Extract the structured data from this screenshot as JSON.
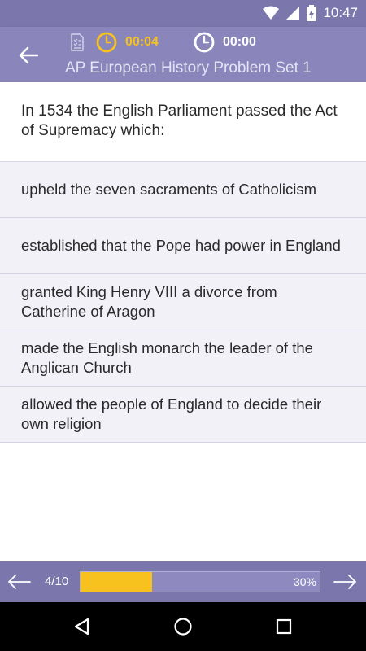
{
  "status_bar": {
    "time": "10:47",
    "icons": [
      "wifi-icon",
      "signal-icon",
      "battery-icon"
    ]
  },
  "app_bar": {
    "title": "AP European History Problem Set 1",
    "elapsed_time": "00:04",
    "total_time": "00:00",
    "icons": [
      "back-arrow-icon",
      "answer-sheet-icon",
      "stopwatch-icon",
      "clock-icon"
    ]
  },
  "question": {
    "text": "In 1534 the English Parliament passed the Act of Supremacy which:"
  },
  "answers": [
    {
      "text": "upheld the seven sacraments of Catholicism"
    },
    {
      "text": "established that the Pope had power in England"
    },
    {
      "text": "granted King Henry VIII a divorce from Catherine of Aragon"
    },
    {
      "text": "made the English monarch the leader of the Anglican Church"
    },
    {
      "text": "allowed the people of England to decide their own religion"
    }
  ],
  "progress": {
    "counter": "4/10",
    "percent_label": "30%",
    "fraction": 0.3
  },
  "colors": {
    "accent": "#f7c21d",
    "app_bar": "#8a86bc",
    "status_bar": "#7b77ad",
    "answer_bg": "#f2f1f8"
  },
  "nav_bar": {
    "icons": [
      "back-triangle-icon",
      "home-circle-icon",
      "recents-square-icon"
    ]
  }
}
